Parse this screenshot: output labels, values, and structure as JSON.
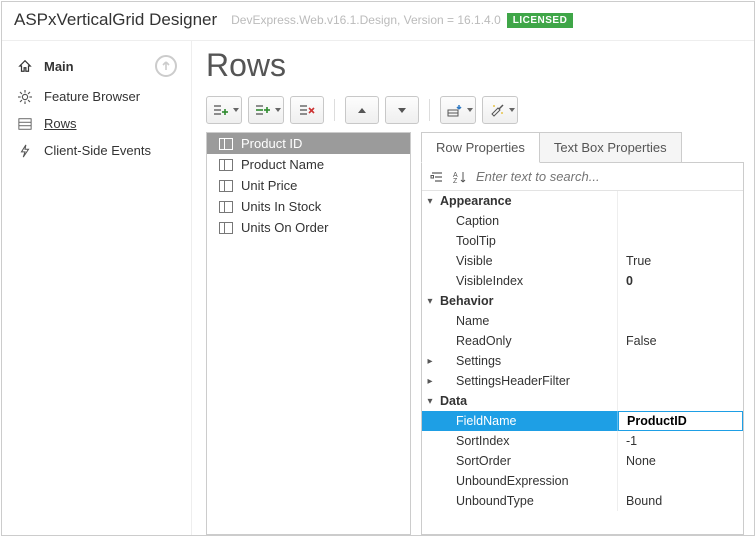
{
  "titlebar": {
    "app_title": "ASPxVerticalGrid Designer",
    "version": "DevExpress.Web.v16.1.Design, Version = 16.1.4.0",
    "license": "LICENSED"
  },
  "sidebar": {
    "main": "Main",
    "items": [
      {
        "label": "Feature Browser",
        "icon": "gear-icon"
      },
      {
        "label": "Rows",
        "icon": "rows-icon",
        "active": true
      },
      {
        "label": "Client-Side Events",
        "icon": "bolt-icon"
      }
    ]
  },
  "page": {
    "title": "Rows"
  },
  "rows": [
    {
      "label": "Product ID",
      "selected": true
    },
    {
      "label": "Product Name"
    },
    {
      "label": "Unit Price"
    },
    {
      "label": "Units In Stock"
    },
    {
      "label": "Units On Order"
    }
  ],
  "tabs": {
    "row_props": "Row Properties",
    "textbox_props": "Text Box Properties"
  },
  "search": {
    "placeholder": "Enter text to search..."
  },
  "props": {
    "appearance": {
      "label": "Appearance",
      "Caption": "",
      "ToolTip": "",
      "Visible": "True",
      "VisibleIndex": "0"
    },
    "behavior": {
      "label": "Behavior",
      "Name": "",
      "ReadOnly": "False",
      "Settings": "Settings",
      "SettingsHeaderFilter": "SettingsHeaderFilter"
    },
    "data": {
      "label": "Data",
      "FieldName": "ProductID",
      "SortIndex": "-1",
      "SortOrder": "None",
      "UnboundExpression": "",
      "UnboundType": "Bound"
    }
  }
}
